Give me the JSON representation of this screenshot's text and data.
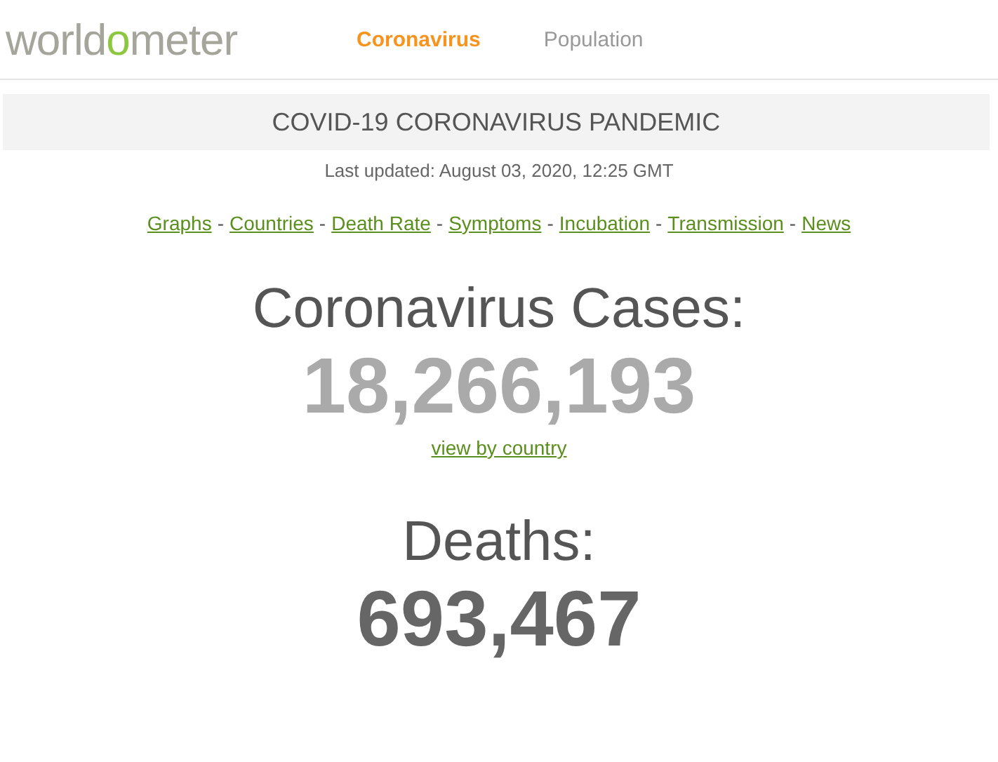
{
  "logo": {
    "before": "world",
    "highlight": "o",
    "after": "meter"
  },
  "nav": [
    {
      "label": "Coronavirus",
      "selected": true
    },
    {
      "label": "Population",
      "selected": false
    }
  ],
  "banner": {
    "title": "COVID-19 CORONAVIRUS PANDEMIC"
  },
  "last_updated": "Last updated: August 03, 2020, 12:25 GMT",
  "links": [
    "Graphs",
    "Countries",
    "Death Rate",
    "Symptoms",
    "Incubation",
    "Transmission",
    "News"
  ],
  "link_separator": "-",
  "counters": [
    {
      "kind": "cases",
      "title": "Coronavirus Cases:",
      "value": "18,266,193",
      "link": "view by country"
    },
    {
      "kind": "deaths",
      "title": "Deaths:",
      "value": "693,467"
    }
  ]
}
